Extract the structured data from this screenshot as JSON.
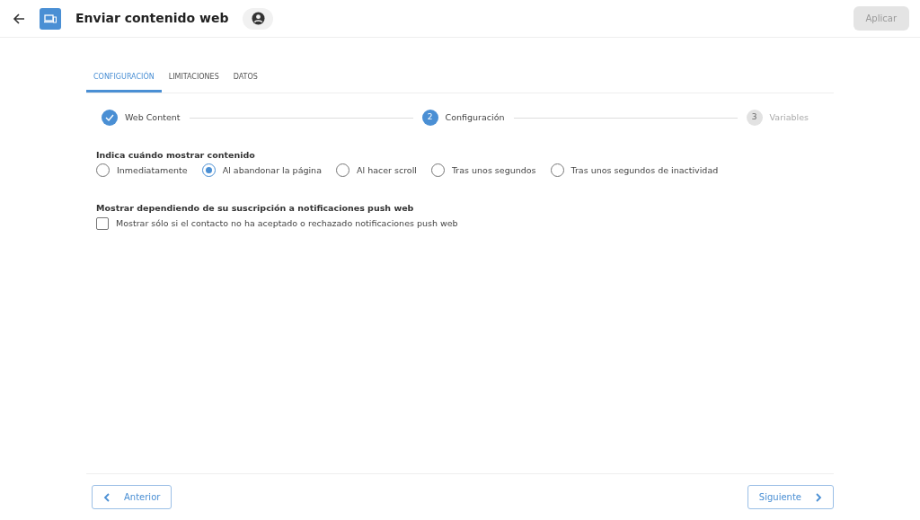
{
  "header": {
    "title": "Enviar contenido web",
    "apply_button": {
      "label": "Aplicar",
      "disabled": true
    }
  },
  "tabs": [
    {
      "label": "CONFIGURACIÓN",
      "selected": true
    },
    {
      "label": "LIMITACIONES",
      "selected": false
    },
    {
      "label": "DATOS",
      "selected": false
    }
  ],
  "steps": [
    {
      "label": "Web Content",
      "kind": "done"
    },
    {
      "number": "2",
      "label": "Configuración",
      "kind": "active"
    },
    {
      "number": "3",
      "label": "Variables",
      "kind": "pending"
    }
  ],
  "show_when": {
    "label": "Indica cuándo mostrar contenido",
    "options": [
      {
        "label": "Inmediatamente",
        "selected": false
      },
      {
        "label": "Al abandonar la página",
        "selected": true
      },
      {
        "label": "Al hacer scroll",
        "selected": false
      },
      {
        "label": "Tras unos segundos",
        "selected": false
      },
      {
        "label": "Tras unos segundos de inactividad",
        "selected": false
      }
    ]
  },
  "push": {
    "label": "Mostrar dependiendo de su suscripción a notificaciones push web",
    "checkbox": {
      "label": "Mostrar sólo si el contacto no ha aceptado o rechazado notificaciones push web",
      "checked": false
    }
  },
  "footer": {
    "previous": "Anterior",
    "next": "Siguiente"
  }
}
